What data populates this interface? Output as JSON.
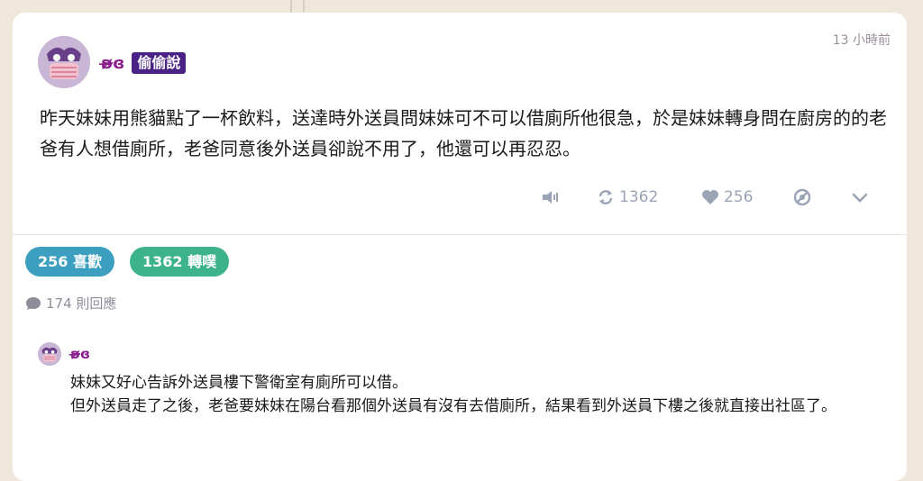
{
  "post": {
    "author": "ʚ̴̶̷̷ɞ",
    "tag": "偷偷說",
    "time": "13 小時前",
    "content": "昨天妹妹用熊貓點了一杯飲料，送達時外送員問妹妹可不可以借廁所他很急，於是妹妹轉身問在廚房的的老爸有人想借廁所，老爸同意後外送員卻說不用了，他還可以再忍忍。",
    "reshares": "1362",
    "likes": "256",
    "icons": {
      "mute": "speaker-mute-icon",
      "reshare": "repeat-icon",
      "like": "heart-icon",
      "block": "block-icon",
      "expand": "chevron-down-icon"
    }
  },
  "stats": {
    "likes_label": "256 喜歡",
    "shares_label": "1362 轉噗",
    "reply_count": "174 則回應"
  },
  "comment": {
    "author": "ʚ̴̶̷̷ɞ",
    "line1": "妹妹又好心告訴外送員樓下警衛室有廁所可以借。",
    "line2": "但外送員走了之後，老爸要妹妹在陽台看那個外送員有沒有去借廁所，結果看到外送員下樓之後就直接出社區了。"
  },
  "colors": {
    "author": "#8a1e8c",
    "tag_bg": "#4a2185",
    "likes_pill": "#3d9fbf",
    "shares_pill": "#3cb38a",
    "icon": "#9aa4b4"
  }
}
